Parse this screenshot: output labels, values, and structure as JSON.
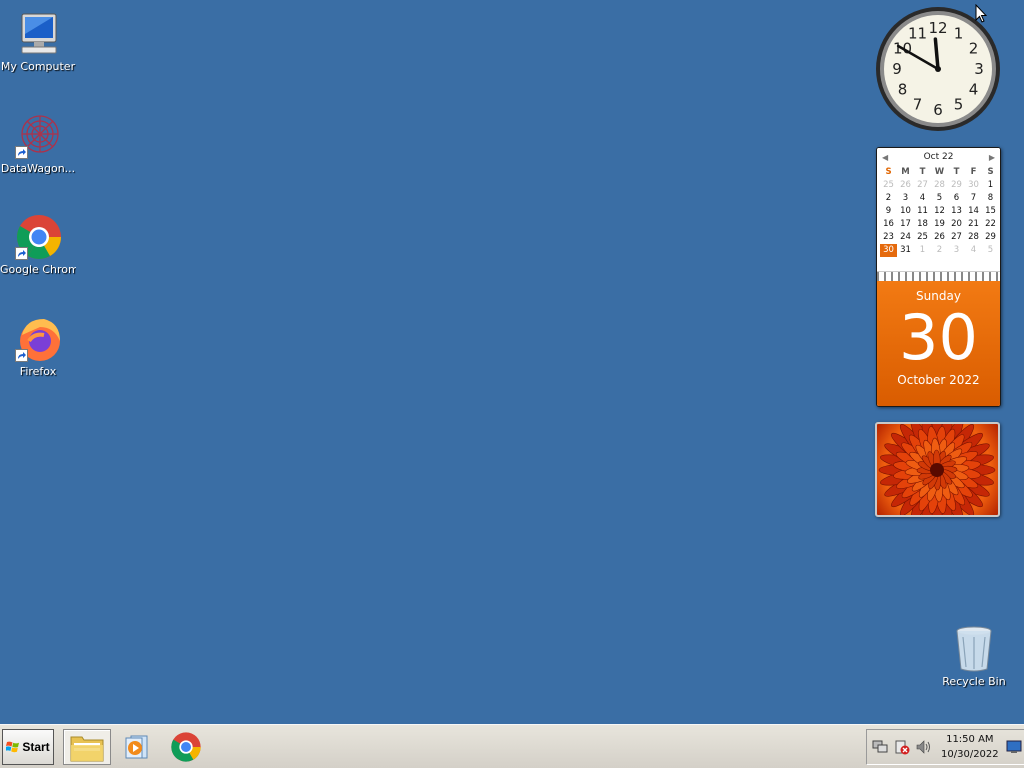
{
  "desktop": {
    "icons": [
      {
        "label": "My Computer"
      },
      {
        "label": "DataWagon..."
      },
      {
        "label": "Google Chrome"
      },
      {
        "label": "Firefox"
      },
      {
        "label": "Recycle Bin"
      }
    ]
  },
  "clock_gadget": {
    "hour": 11,
    "minute": 50,
    "numerals": [
      "12",
      "1",
      "2",
      "3",
      "4",
      "5",
      "6",
      "7",
      "8",
      "9",
      "10",
      "11"
    ]
  },
  "calendar_gadget": {
    "month_label": "Oct 22",
    "weekdays": [
      "S",
      "M",
      "T",
      "W",
      "T",
      "F",
      "S"
    ],
    "rows": [
      [
        "25",
        "26",
        "27",
        "28",
        "29",
        "30",
        "1"
      ],
      [
        "2",
        "3",
        "4",
        "5",
        "6",
        "7",
        "8"
      ],
      [
        "9",
        "10",
        "11",
        "12",
        "13",
        "14",
        "15"
      ],
      [
        "16",
        "17",
        "18",
        "19",
        "20",
        "21",
        "22"
      ],
      [
        "23",
        "24",
        "25",
        "26",
        "27",
        "28",
        "29"
      ],
      [
        "30",
        "31",
        "1",
        "2",
        "3",
        "4",
        "5"
      ]
    ],
    "day_name": "Sunday",
    "day_number": "30",
    "month_year": "October 2022"
  },
  "taskbar": {
    "start_label": "Start",
    "time": "11:50 AM",
    "date": "10/30/2022"
  },
  "colors": {
    "desktop_bg": "#3a6ea5",
    "calendar_accent": "#e56a0d"
  }
}
